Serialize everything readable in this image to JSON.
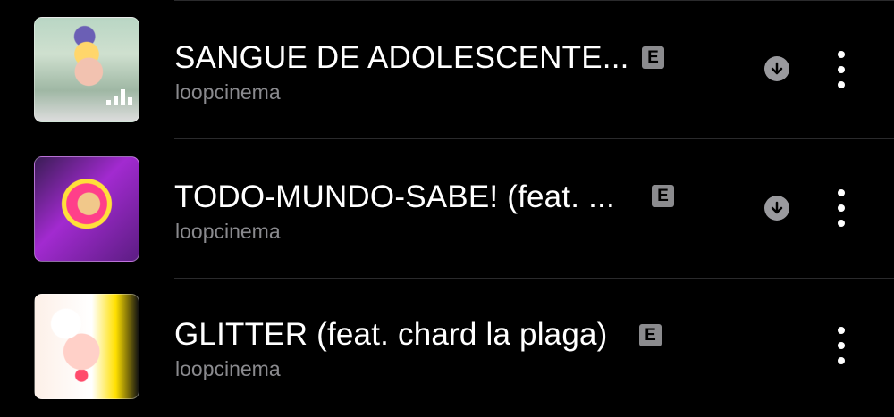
{
  "tracks": [
    {
      "title": "SANGUE DE ADOLESCENTE...",
      "explicit": "E",
      "artist": "loopcinema",
      "downloadable": true,
      "now_playing": true
    },
    {
      "title": "TODO-MUNDO-SABE! (feat. ...",
      "explicit": "E",
      "artist": "loopcinema",
      "downloadable": true,
      "now_playing": false
    },
    {
      "title": "GLITTER (feat. chard la plaga)",
      "explicit": "E",
      "artist": "loopcinema",
      "downloadable": false,
      "now_playing": false
    }
  ],
  "icons": {
    "download": "download-arrow-icon",
    "more": "more-options-icon",
    "playing": "now-playing-equalizer-icon"
  },
  "colors": {
    "background": "#000000",
    "primary_text": "#ffffff",
    "secondary_text": "#8a8a8e",
    "badge": "#8b8b8e",
    "divider": "#2a2a2c"
  }
}
